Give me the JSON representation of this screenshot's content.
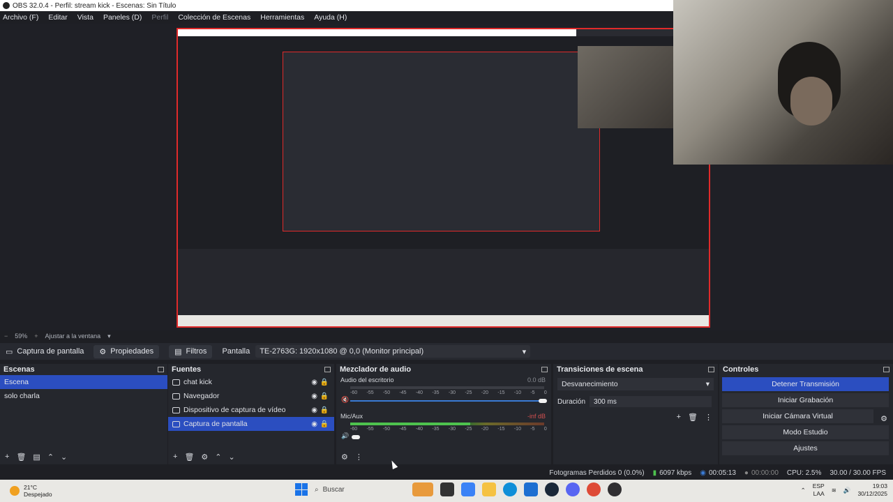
{
  "window": {
    "title": "OBS 32.0.4 - Perfil: stream kick - Escenas: Sin Título"
  },
  "menu": [
    "Archivo (F)",
    "Editar",
    "Vista",
    "Paneles (D)",
    "Perfil",
    "Colección de Escenas",
    "Herramientas",
    "Ayuda (H)"
  ],
  "zoom": {
    "percent": "59%",
    "fit_label": "Ajustar a la ventana"
  },
  "source_toolbar": {
    "current_source": "Captura de pantalla",
    "properties": "Propiedades",
    "filters": "Filtros",
    "display_label": "Pantalla",
    "display_value": "TE-2763G: 1920x1080 @ 0,0 (Monitor principal)"
  },
  "scenes": {
    "title": "Escenas",
    "items": [
      "Escena",
      "solo charla"
    ],
    "selected": 0
  },
  "sources": {
    "title": "Fuentes",
    "items": [
      {
        "label": "chat kick",
        "icon": "browser-icon"
      },
      {
        "label": "Navegador",
        "icon": "browser-icon"
      },
      {
        "label": "Dispositivo de captura de vídeo",
        "icon": "camera-icon"
      },
      {
        "label": "Captura de pantalla",
        "icon": "monitor-icon"
      }
    ],
    "selected": 3
  },
  "mixer": {
    "title": "Mezclador de audio",
    "channels": [
      {
        "name": "Audio del escritorio",
        "db": "0.0 dB",
        "level": 0.0
      },
      {
        "name": "Mic/Aux",
        "db": "-inf dB",
        "level": 0.62
      }
    ],
    "ticks": [
      "-60",
      "-55",
      "-50",
      "-45",
      "-40",
      "-35",
      "-30",
      "-25",
      "-20",
      "-15",
      "-10",
      "-5",
      "0"
    ]
  },
  "transitions": {
    "title": "Transiciones de escena",
    "selected": "Desvanecimiento",
    "duration_label": "Duración",
    "duration_value": "300 ms"
  },
  "controls": {
    "title": "Controles",
    "buttons": [
      "Detener Transmisión",
      "Iniciar Grabación",
      "Iniciar Cámara Virtual",
      "Modo Estudio",
      "Ajustes"
    ]
  },
  "status": {
    "dropped": "Fotogramas Perdidos 0 (0.0%)",
    "bitrate": "6097 kbps",
    "stream_time": "00:05:13",
    "rec_time": "00:00:00",
    "cpu": "CPU: 2.5%",
    "fps": "30.00 / 30.00 FPS"
  },
  "taskbar": {
    "temp": "21°C",
    "weather": "Despejado",
    "search": "Buscar",
    "lang1": "ESP",
    "lang2": "LAA",
    "time": "19:03",
    "date": "30/12/2025"
  },
  "colors": {
    "accent": "#2b4ec0",
    "selection_red": "#e02a2a"
  }
}
